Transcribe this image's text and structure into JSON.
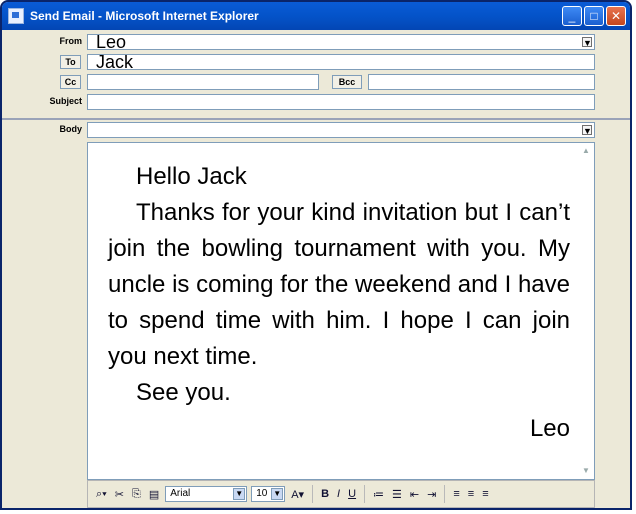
{
  "window": {
    "title": "Send Email - Microsoft Internet Explorer",
    "buttons": [
      "_",
      "□",
      "✕"
    ]
  },
  "form": {
    "from_label": "From",
    "from_value": "Leo",
    "to_button": "To",
    "to_value": "Jack",
    "cc_button": "Cc",
    "cc_value": "",
    "bcc_button": "Bcc",
    "bcc_value": "",
    "subject_label": "Subject",
    "subject_value": "",
    "body_label": "Body",
    "body_select_value": ""
  },
  "message": {
    "greeting": "Hello Jack",
    "paragraph": "Thanks for your kind invitation but I can’t join the bowling tournament with you. My uncle is coming for the weekend and I have to spend time with him. I hope I can join you next time.",
    "closing": "See you.",
    "signature": "Leo"
  },
  "toolbar": {
    "font_name": "Arial",
    "font_size": "10",
    "bold": "B",
    "italic": "I",
    "underline": "U"
  }
}
